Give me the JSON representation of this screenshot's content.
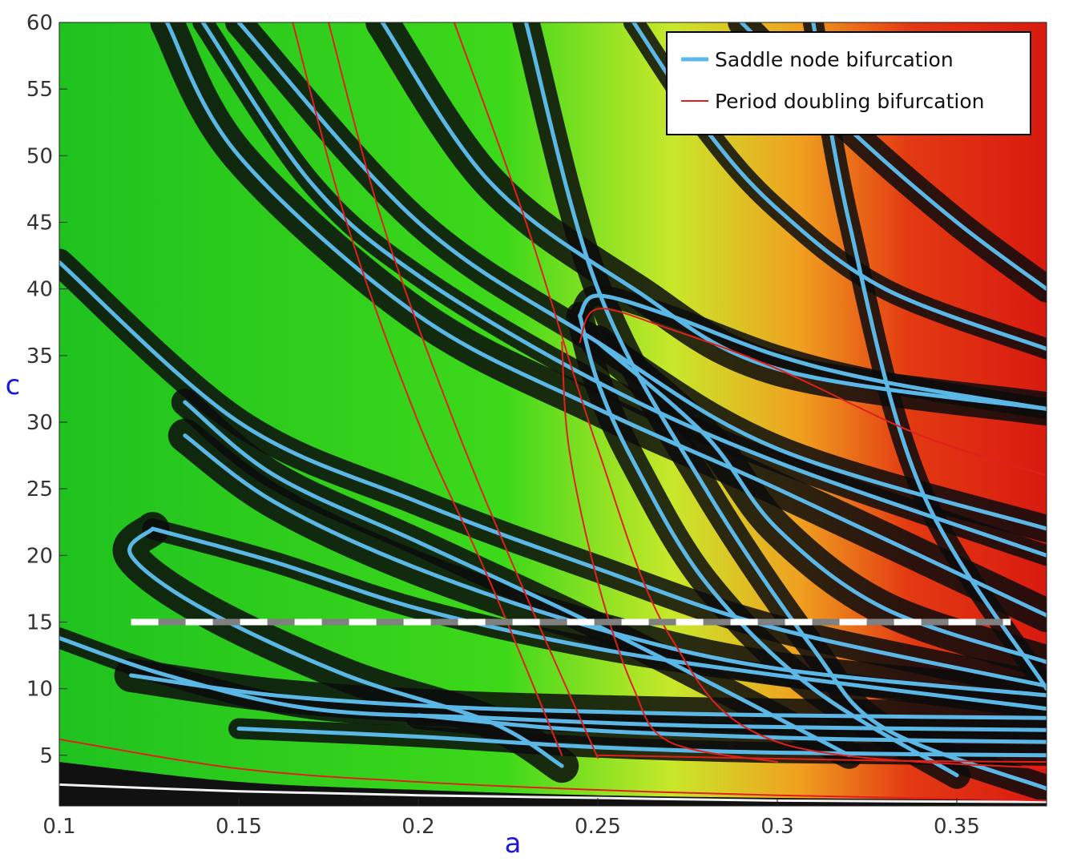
{
  "chart_data": {
    "type": "line",
    "xlabel": "a",
    "ylabel": "c",
    "xlim": [
      0.1,
      0.375
    ],
    "ylim": [
      1.2,
      60
    ],
    "x_ticks": [
      "0.1",
      "0.15",
      "0.2",
      "0.25",
      "0.3",
      "0.35"
    ],
    "y_ticks": [
      "5",
      "10",
      "15",
      "20",
      "25",
      "30",
      "35",
      "40",
      "45",
      "50",
      "55",
      "60"
    ],
    "background": "parameter-plane heatmap: black/white bands (periodic regions), green to yellow to red (chaotic regions, increasing Lyapunov exponent)",
    "legend": {
      "position": "top-right",
      "entries": [
        {
          "label": "Saddle node bifurcation",
          "color": "#5bb8e6"
        },
        {
          "label": "Period doubling bifurcation",
          "color": "#e0201c"
        }
      ]
    },
    "reference_line": {
      "c": 15,
      "a_start": 0.12,
      "a_end": 0.365,
      "style": "dashed white/gray"
    },
    "series": [
      {
        "kind": "saddle",
        "x": [
          0.1,
          0.13,
          0.17,
          0.22,
          0.28,
          0.375
        ],
        "y": [
          13.8,
          11,
          8.5,
          7.8,
          7.2,
          6.9
        ]
      },
      {
        "kind": "saddle",
        "x": [
          0.1,
          0.15,
          0.2,
          0.25,
          0.3,
          0.375
        ],
        "y": [
          42,
          30,
          24,
          19,
          14.5,
          10.2
        ]
      },
      {
        "kind": "saddle",
        "x": [
          0.13,
          0.15,
          0.2,
          0.25,
          0.3,
          0.375
        ],
        "y": [
          60,
          50,
          38,
          31,
          25,
          15.5
        ]
      },
      {
        "kind": "saddle",
        "x": [
          0.14,
          0.17,
          0.2,
          0.25,
          0.3,
          0.375
        ],
        "y": [
          60,
          48,
          41,
          33,
          27,
          20
        ]
      },
      {
        "kind": "saddle",
        "x": [
          0.15,
          0.2,
          0.25,
          0.3,
          0.375
        ],
        "y": [
          60,
          45,
          36,
          28,
          22
        ]
      },
      {
        "kind": "saddle",
        "x": [
          0.19,
          0.22,
          0.26,
          0.3,
          0.375
        ],
        "y": [
          60,
          48,
          40,
          34,
          31
        ]
      },
      {
        "kind": "saddle",
        "x": [
          0.26,
          0.28,
          0.3,
          0.33,
          0.375
        ],
        "y": [
          60,
          52,
          46,
          40,
          35.5
        ]
      },
      {
        "kind": "saddle",
        "x": [
          0.29,
          0.32,
          0.35,
          0.375
        ],
        "y": [
          60,
          52,
          45,
          40
        ]
      },
      {
        "kind": "saddle",
        "x": [
          0.126,
          0.12,
          0.14,
          0.18,
          0.22,
          0.24
        ],
        "y": [
          22,
          20,
          16,
          11,
          7.5,
          4.2
        ]
      },
      {
        "kind": "saddle",
        "x": [
          0.126,
          0.16,
          0.2,
          0.25,
          0.3,
          0.375
        ],
        "y": [
          22,
          19.5,
          16,
          13,
          11,
          8.5
        ]
      },
      {
        "kind": "saddle",
        "x": [
          0.135,
          0.16,
          0.2,
          0.24,
          0.27,
          0.32
        ],
        "y": [
          31.5,
          26,
          21,
          16,
          12,
          5
        ]
      },
      {
        "kind": "saddle",
        "x": [
          0.135,
          0.16,
          0.2,
          0.25,
          0.3,
          0.375
        ],
        "y": [
          29,
          24,
          19,
          14.5,
          11.5,
          9.5
        ]
      },
      {
        "kind": "saddle",
        "x": [
          0.245,
          0.25,
          0.27,
          0.3,
          0.33,
          0.375
        ],
        "y": [
          38,
          39.5,
          38,
          35,
          33,
          31
        ]
      },
      {
        "kind": "saddle",
        "x": [
          0.245,
          0.25,
          0.26,
          0.28,
          0.31,
          0.35
        ],
        "y": [
          38,
          33,
          27,
          18,
          10,
          3.5
        ]
      },
      {
        "kind": "saddle",
        "x": [
          0.25,
          0.28,
          0.3,
          0.33,
          0.375
        ],
        "y": [
          36,
          29,
          22,
          16,
          12
        ]
      },
      {
        "kind": "saddle",
        "x": [
          0.31,
          0.32,
          0.34,
          0.375
        ],
        "y": [
          60,
          45,
          25,
          10
        ]
      },
      {
        "kind": "saddle",
        "x": [
          0.23,
          0.25,
          0.28,
          0.31,
          0.33,
          0.375
        ],
        "y": [
          60,
          40,
          25,
          13,
          7,
          2.5
        ]
      },
      {
        "kind": "saddle",
        "x": [
          0.12,
          0.16,
          0.21,
          0.26,
          0.3,
          0.375
        ],
        "y": [
          11,
          9.5,
          8.6,
          8.2,
          8,
          7.8
        ]
      },
      {
        "kind": "saddle",
        "x": [
          0.15,
          0.2,
          0.25,
          0.3,
          0.375
        ],
        "y": [
          7,
          6.4,
          5.6,
          5.2,
          5
        ]
      },
      {
        "kind": "saddle",
        "x": [
          0.2,
          0.24,
          0.28,
          0.32,
          0.375
        ],
        "y": [
          8,
          7,
          6.5,
          6.2,
          6
        ]
      },
      {
        "kind": "pd",
        "x": [
          0.1,
          0.15,
          0.2,
          0.25,
          0.3,
          0.375
        ],
        "y": [
          6.2,
          4,
          3,
          2.4,
          2,
          1.6
        ]
      },
      {
        "kind": "pd",
        "x": [
          0.165,
          0.18,
          0.2,
          0.22,
          0.24
        ],
        "y": [
          60,
          45,
          30,
          18,
          5
        ]
      },
      {
        "kind": "pd",
        "x": [
          0.175,
          0.19,
          0.21,
          0.23,
          0.25
        ],
        "y": [
          60,
          45,
          30,
          17,
          4.8
        ]
      },
      {
        "kind": "pd",
        "x": [
          0.21,
          0.23,
          0.25,
          0.27,
          0.3,
          0.375
        ],
        "y": [
          60,
          45,
          28,
          14,
          6,
          4
        ]
      },
      {
        "kind": "pd",
        "x": [
          0.245,
          0.25,
          0.27,
          0.3,
          0.34,
          0.375
        ],
        "y": [
          36,
          38.5,
          37,
          34,
          29,
          26
        ]
      },
      {
        "kind": "pd",
        "x": [
          0.24,
          0.242,
          0.25,
          0.26,
          0.27,
          0.3
        ],
        "y": [
          36,
          28,
          18,
          10,
          6,
          4.5
        ]
      },
      {
        "kind": "pd",
        "x": [
          0.25,
          0.29,
          0.33,
          0.375
        ],
        "y": [
          5,
          4.8,
          4.6,
          4.5
        ]
      }
    ]
  }
}
